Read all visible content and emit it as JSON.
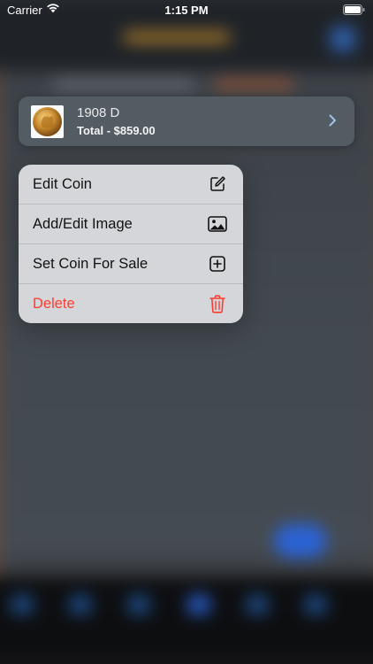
{
  "status_bar": {
    "carrier": "Carrier",
    "time": "1:15 PM"
  },
  "preview": {
    "coin_name": "1908 D",
    "total": "Total - $859.00"
  },
  "context_menu": {
    "items": [
      {
        "label": "Edit Coin",
        "icon": "square-pencil-icon",
        "destructive": false
      },
      {
        "label": "Add/Edit Image",
        "icon": "photo-icon",
        "destructive": false
      },
      {
        "label": "Set Coin For Sale",
        "icon": "plus-square-icon",
        "destructive": false
      },
      {
        "label": "Delete",
        "icon": "trash-icon",
        "destructive": true
      }
    ]
  },
  "colors": {
    "destructive": "#ff3b30",
    "menu_background": "#d4d6d9",
    "card_background": "#545c63",
    "accent_blue": "#2a63d6"
  }
}
